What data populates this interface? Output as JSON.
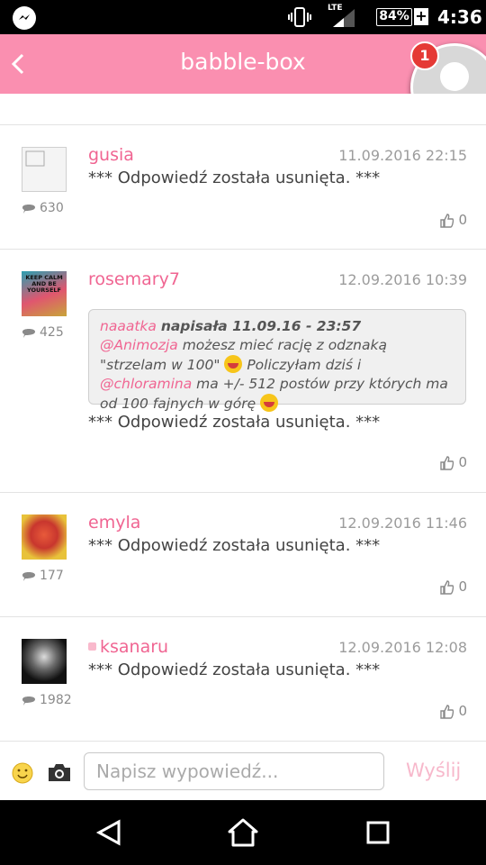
{
  "status_bar": {
    "network": "LTE",
    "battery": "84%",
    "time": "4:36"
  },
  "header": {
    "title": "babble-box",
    "notification_count": "1"
  },
  "posts": [
    {
      "author": "gusia",
      "date": "11.09.2016 22:15",
      "text": "*** Odpowiedź została usunięta. ***",
      "post_count": "630",
      "likes": "0"
    },
    {
      "author": "rosemary7",
      "date": "12.09.2016 10:39",
      "avatar_text": "KEEP CALM AND BE YOURSELF",
      "quote": {
        "author": "naaatka",
        "header": "napisała 11.09.16 - 23:57",
        "mention1": "@Animozja",
        "text1": " możesz mieć rację z odznaką \"strzelam w 100\" ",
        "text2": " Policzyłam dziś i ",
        "mention2": "@chloramina",
        "text3": " ma +/- 512 postów przy których ma od 100 fajnych w górę "
      },
      "text": "*** Odpowiedź została usunięta. ***",
      "post_count": "425",
      "likes": "0"
    },
    {
      "author": "emyla",
      "date": "12.09.2016 11:46",
      "text": "*** Odpowiedź została usunięta. ***",
      "post_count": "177",
      "likes": "0"
    },
    {
      "author": "ksanaru",
      "date": "12.09.2016 12:08",
      "text": "*** Odpowiedź została usunięta. ***",
      "post_count": "1982",
      "likes": "0"
    }
  ],
  "composer": {
    "placeholder": "Napisz wypowiedź...",
    "send_label": "Wyślij"
  },
  "colors": {
    "brand": "#fa8fb0",
    "author": "#f06592",
    "send": "#f7b8cb"
  }
}
